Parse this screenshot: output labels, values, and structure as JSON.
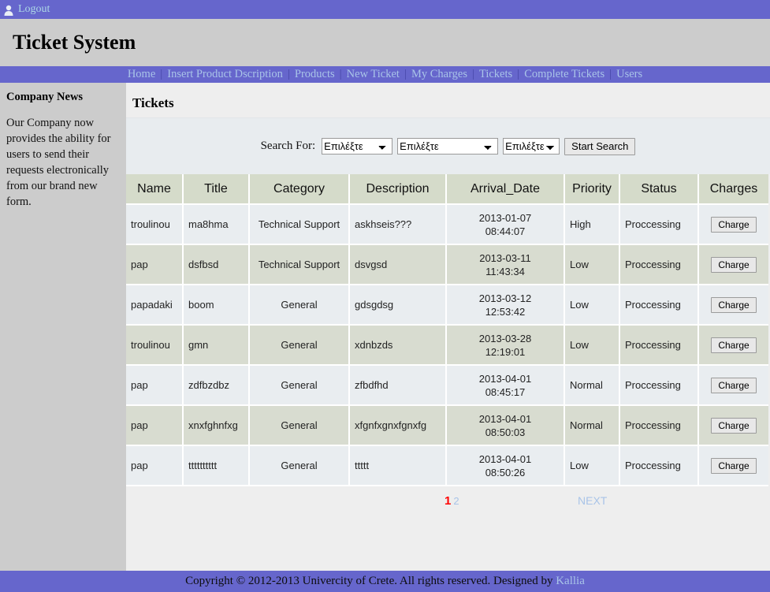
{
  "topbar": {
    "logout_label": "Logout",
    "icon": "user-icon"
  },
  "banner": {
    "title": "Ticket System"
  },
  "nav": {
    "items": [
      {
        "label": "Home"
      },
      {
        "label": "Insert Product Dscription"
      },
      {
        "label": "Products"
      },
      {
        "label": "New Ticket"
      },
      {
        "label": "My Charges"
      },
      {
        "label": "Tickets"
      },
      {
        "label": "Complete Tickets"
      },
      {
        "label": "Users"
      }
    ],
    "separator": "|"
  },
  "sidebar": {
    "heading": "Company News",
    "body": "Our Company now provides the ability for users to send their requests electronically from our brand new form."
  },
  "main": {
    "page_title": "Tickets"
  },
  "search": {
    "label": "Search For:",
    "select1_value": "Επιλέξτε",
    "select2_value": "Επιλέξτε",
    "select3_value": "Επιλέξτε",
    "button_label": "Start Search"
  },
  "table": {
    "headers": [
      "Name",
      "Title",
      "Category",
      "Description",
      "Arrival_Date",
      "Priority",
      "Status",
      "Charges"
    ],
    "rows": [
      {
        "name": "troulinou",
        "title": "ma8hma",
        "category": "Technical Support",
        "description": "askhseis???",
        "date": "2013-01-07",
        "time": "08:44:07",
        "priority": "High",
        "status": "Proccessing",
        "action": "Charge"
      },
      {
        "name": "pap",
        "title": "dsfbsd",
        "category": "Technical Support",
        "description": "dsvgsd",
        "date": "2013-03-11",
        "time": "11:43:34",
        "priority": "Low",
        "status": "Proccessing",
        "action": "Charge"
      },
      {
        "name": "papadaki",
        "title": "boom",
        "category": "General",
        "description": "gdsgdsg",
        "date": "2013-03-12",
        "time": "12:53:42",
        "priority": "Low",
        "status": "Proccessing",
        "action": "Charge"
      },
      {
        "name": "troulinou",
        "title": "gmn",
        "category": "General",
        "description": "xdnbzds",
        "date": "2013-03-28",
        "time": "12:19:01",
        "priority": "Low",
        "status": "Proccessing",
        "action": "Charge"
      },
      {
        "name": "pap",
        "title": "zdfbzdbz",
        "category": "General",
        "description": "zfbdfhd",
        "date": "2013-04-01",
        "time": "08:45:17",
        "priority": "Normal",
        "status": "Proccessing",
        "action": "Charge"
      },
      {
        "name": "pap",
        "title": "xnxfghnfxg",
        "category": "General",
        "description": "xfgnfxgnxfgnxfg",
        "date": "2013-04-01",
        "time": "08:50:03",
        "priority": "Normal",
        "status": "Proccessing",
        "action": "Charge"
      },
      {
        "name": "pap",
        "title": "tttttttttt",
        "category": "General",
        "description": "ttttt",
        "date": "2013-04-01",
        "time": "08:50:26",
        "priority": "Low",
        "status": "Proccessing",
        "action": "Charge"
      }
    ]
  },
  "pagination": {
    "current": "1",
    "other": "2",
    "next_label": "NEXT"
  },
  "footer": {
    "text": "Copyright © 2012-2013 Univercity of Crete. All rights reserved. Designed by ",
    "author": "Kallia"
  },
  "colors": {
    "purple": "#6666cc",
    "sidebar_gray": "#cccccc",
    "content_gray": "#eeeeee",
    "table_header": "#d5dbca",
    "row_odd": "#e9edf0",
    "row_even": "#d8dcd0",
    "link_blue": "#a9c4e8",
    "current_page_red": "#ff0000"
  }
}
